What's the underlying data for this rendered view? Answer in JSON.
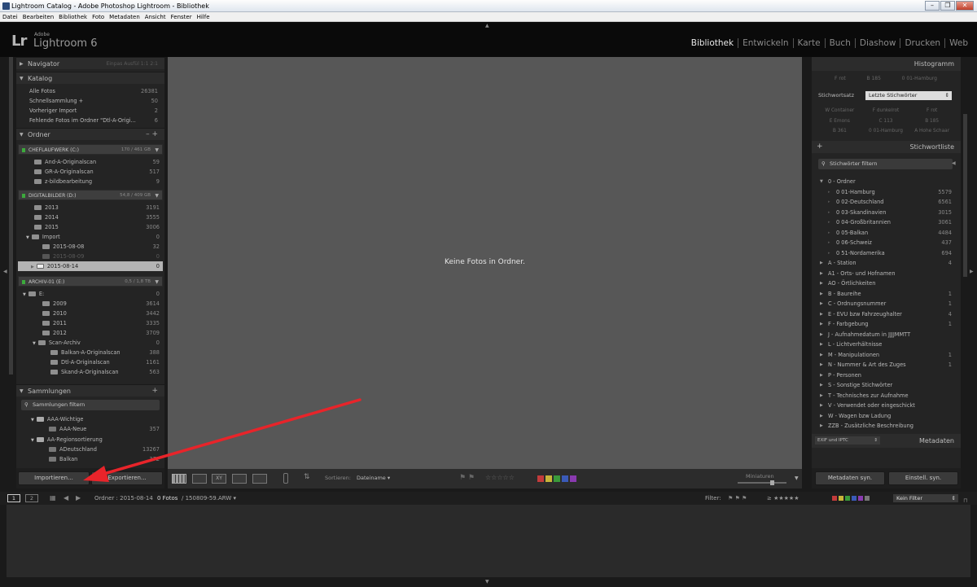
{
  "window": {
    "title": "Lightroom Catalog - Adobe Photoshop Lightroom - Bibliothek"
  },
  "menu": [
    "Datei",
    "Bearbeiten",
    "Bibliothek",
    "Foto",
    "Metadaten",
    "Ansicht",
    "Fenster",
    "Hilfe"
  ],
  "brand": {
    "lr": "Lr",
    "adobe": "Adobe",
    "name": "Lightroom 6"
  },
  "modules": [
    "Bibliothek",
    "Entwickeln",
    "Karte",
    "Buch",
    "Diashow",
    "Drucken",
    "Web"
  ],
  "navigator": {
    "title": "Navigator",
    "options": "Einpas   Ausfül   1:1   2:1"
  },
  "catalog": {
    "title": "Katalog",
    "items": [
      {
        "label": "Alle Fotos",
        "count": "26381"
      },
      {
        "label": "Schnellsammlung  +",
        "count": "50"
      },
      {
        "label": "Vorheriger Import",
        "count": "2"
      },
      {
        "label": "Fehlende Fotos im Ordner \"Dtl-A-Origi...",
        "count": "6"
      }
    ]
  },
  "folders": {
    "title": "Ordner",
    "vol1": {
      "label": "CHEFLAUFWERK (C:)",
      "size": "170 / 461 GB"
    },
    "vol1_items": [
      {
        "label": "And-A-Originalscan",
        "count": "59"
      },
      {
        "label": "GR-A-Originalscan",
        "count": "517"
      },
      {
        "label": "z-bildbearbeitung",
        "count": "9"
      }
    ],
    "vol2": {
      "label": "DIGITALBILDER (D:)",
      "size": "54,8 / 409 GB"
    },
    "vol2_items": [
      {
        "label": "2013",
        "count": "3191"
      },
      {
        "label": "2014",
        "count": "3555"
      },
      {
        "label": "2015",
        "count": "3006"
      },
      {
        "label": "Import",
        "count": "0"
      },
      {
        "label": "2015-08-08",
        "count": "32"
      },
      {
        "label": "2015-08-09",
        "count": "0"
      },
      {
        "label": "2015-08-14",
        "count": "0"
      }
    ],
    "vol3": {
      "label": "ARCHIV-01 (E:)",
      "size": "0,5 / 1,8 TB"
    },
    "vol3_items": [
      {
        "label": "E:",
        "count": "0"
      },
      {
        "label": "2009",
        "count": "3614"
      },
      {
        "label": "2010",
        "count": "3442"
      },
      {
        "label": "2011",
        "count": "3335"
      },
      {
        "label": "2012",
        "count": "3709"
      },
      {
        "label": "Scan-Archiv",
        "count": "0"
      },
      {
        "label": "Balkan-A-Originalscan",
        "count": "388"
      },
      {
        "label": "Dtl-A-Originalscan",
        "count": "1161"
      },
      {
        "label": "Skand-A-Originalscan",
        "count": "563"
      }
    ]
  },
  "collections": {
    "title": "Sammlungen",
    "filter_placeholder": "Sammlungen filtern",
    "items": [
      {
        "label": "AAA-Wichtige",
        "count": ""
      },
      {
        "label": "AAA-Neue",
        "count": "357"
      },
      {
        "label": "AA-Regionsortierung",
        "count": ""
      },
      {
        "label": "ADeutschland",
        "count": "13267"
      },
      {
        "label": "Balkan",
        "count": "372"
      }
    ]
  },
  "buttons": {
    "import": "Importieren...",
    "export": "Exportieren...",
    "sync_meta": "Metadaten syn.",
    "sync_settings": "Einstell. syn."
  },
  "center": {
    "message": "Keine Fotos in Ordner."
  },
  "toolbar": {
    "sort_label": "Sortieren:",
    "sort_value": "Dateiname",
    "thumb_label": "Miniaturen",
    "xy": "XY"
  },
  "histogram": {
    "title": "Histogramm"
  },
  "keyword_top": {
    "row1": [
      "F rot",
      "B 185",
      "0 01-Hamburg"
    ],
    "set_label": "Stichwortsatz",
    "set_value": "Letzte Stichwörter",
    "grid": [
      "W Container",
      "F dunkelrot",
      "F rot",
      "E Emons",
      "C 113",
      "B 185",
      "B 361",
      "0 01-Hamburg",
      "A Hohe Schaar"
    ]
  },
  "keywordlist": {
    "title": "Stichwortliste",
    "filter_placeholder": "Stichwörter filtern",
    "items": [
      {
        "label": "0 - Ordner",
        "count": "",
        "indent": 0,
        "open": true
      },
      {
        "label": "0 01-Hamburg",
        "count": "5579",
        "indent": 1
      },
      {
        "label": "0 02-Deutschland",
        "count": "6561",
        "indent": 1
      },
      {
        "label": "0 03-Skandinavien",
        "count": "3015",
        "indent": 1
      },
      {
        "label": "0 04-Großbritannien",
        "count": "3061",
        "indent": 1
      },
      {
        "label": "0 05-Balkan",
        "count": "4484",
        "indent": 1
      },
      {
        "label": "0 06-Schweiz",
        "count": "437",
        "indent": 1
      },
      {
        "label": "0 51-Nordamerika",
        "count": "694",
        "indent": 1
      },
      {
        "label": "A - Station",
        "count": "4",
        "indent": 0
      },
      {
        "label": "A1 - Orts- und Hofnamen",
        "count": "",
        "indent": 0
      },
      {
        "label": "AO - Örtlichkeiten",
        "count": "",
        "indent": 0
      },
      {
        "label": "B - Baureihe",
        "count": "1",
        "indent": 0
      },
      {
        "label": "C - Ordnungsnummer",
        "count": "1",
        "indent": 0
      },
      {
        "label": "E - EVU bzw Fahrzeughalter",
        "count": "4",
        "indent": 0
      },
      {
        "label": "F - Farbgebung",
        "count": "1",
        "indent": 0
      },
      {
        "label": "J - Aufnahmedatum in JJJJMMTT",
        "count": "",
        "indent": 0
      },
      {
        "label": "L - Lichtverhältnisse",
        "count": "",
        "indent": 0
      },
      {
        "label": "M - Manipulationen",
        "count": "1",
        "indent": 0
      },
      {
        "label": "N - Nummer & Art des Zuges",
        "count": "1",
        "indent": 0
      },
      {
        "label": "P - Personen",
        "count": "",
        "indent": 0
      },
      {
        "label": "S - Sonstige Stichwörter",
        "count": "",
        "indent": 0
      },
      {
        "label": "T - Technisches zur Aufnahme",
        "count": "",
        "indent": 0
      },
      {
        "label": "V - Verwendet oder eingeschickt",
        "count": "",
        "indent": 0
      },
      {
        "label": "W - Wagen bzw Ladung",
        "count": "",
        "indent": 0
      },
      {
        "label": "ZZB - Zusätzliche Beschreibung",
        "count": "",
        "indent": 0
      }
    ]
  },
  "metadata": {
    "title": "Metadaten",
    "preset": "EXIF und IPTC"
  },
  "filmstrip": {
    "page1": "1",
    "page2": "2",
    "path_label": "Ordner : 2015-08-14",
    "photos": "0 Fotos",
    "file": "/ 150809-59.ARW",
    "filter_label": "Filter:",
    "filter_value": "Kein Filter"
  },
  "colors": {
    "red": "#c23b3b",
    "yellow": "#c8b43a",
    "green": "#3a9a3a",
    "blue": "#3a5ab8",
    "purple": "#8a3ab0",
    "arrow": "#e8242a"
  }
}
